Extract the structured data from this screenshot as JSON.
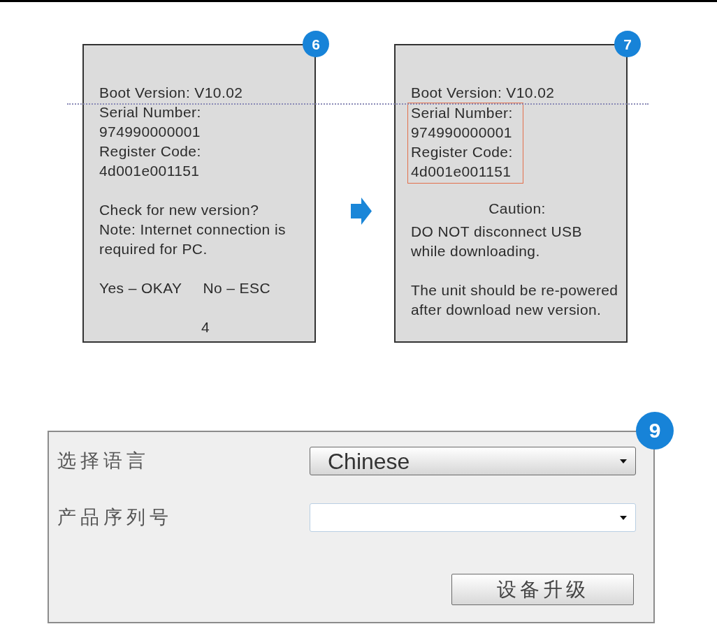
{
  "screens": [
    {
      "badge": "6",
      "sections": [
        {
          "kind": "text",
          "lines": [
            {
              "text": "Boot Version: V10.02",
              "highlighted": false
            },
            {
              "text": "Serial Number:",
              "highlighted": false
            },
            {
              "text": "974990000001",
              "highlighted": false
            },
            {
              "text": "Register Code:",
              "highlighted": false
            },
            {
              "text": "4d001e001151",
              "highlighted": false
            }
          ]
        },
        {
          "kind": "text",
          "lines": [
            {
              "text": "Check for new version?",
              "highlighted": false
            },
            {
              "text": "Note: Internet connection is",
              "highlighted": false
            },
            {
              "text": "required for PC.",
              "highlighted": false
            }
          ]
        },
        {
          "kind": "choices",
          "lines": [
            {
              "text": "Yes – OKAY",
              "highlighted": false
            },
            {
              "text": "No – ESC",
              "highlighted": false
            }
          ]
        },
        {
          "kind": "page",
          "lines": [
            {
              "text": "4",
              "highlighted": false
            }
          ]
        }
      ]
    },
    {
      "badge": "7",
      "sections": [
        {
          "kind": "text",
          "lines": [
            {
              "text": "Boot Version: V10.02",
              "highlighted": false
            },
            {
              "text": "Serial Number:",
              "highlighted": true
            },
            {
              "text": "974990000001",
              "highlighted": true
            },
            {
              "text": "Register Code:",
              "highlighted": true
            },
            {
              "text": "4d001e001151",
              "highlighted": true
            }
          ]
        },
        {
          "kind": "text",
          "heading": "Caution:",
          "lines": [
            {
              "text": "DO NOT disconnect USB",
              "highlighted": false
            },
            {
              "text": "while downloading.",
              "highlighted": false
            }
          ]
        },
        {
          "kind": "text",
          "lines": [
            {
              "text": "The unit should be re-powered",
              "highlighted": false
            },
            {
              "text": "after download new version.",
              "highlighted": false
            }
          ]
        }
      ]
    }
  ],
  "upgrade_panel": {
    "badge": "9",
    "fields": [
      {
        "label": "选择语言",
        "kind": "dropdown",
        "value": "Chinese"
      },
      {
        "label": "产品序列号",
        "kind": "combo"
      }
    ],
    "button": "设备升级"
  }
}
